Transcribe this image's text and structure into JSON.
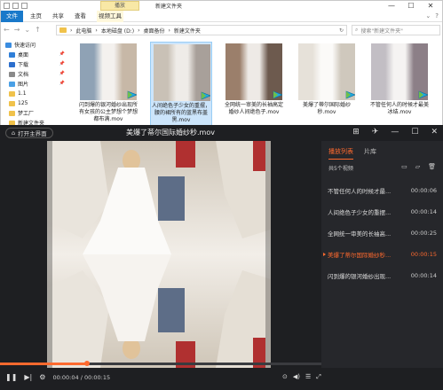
{
  "explorer": {
    "title": "新建文件夹",
    "context_tab": "播放",
    "window_controls": {
      "minimize": "—",
      "maximize": "☐",
      "close": "✕"
    },
    "ribbon": {
      "file": "文件",
      "tabs": [
        "主页",
        "共享",
        "查看",
        "视频工具"
      ]
    },
    "path": [
      "此电脑",
      "本地磁盘 (D:)",
      "桌面备份",
      "新建文件夹"
    ],
    "search_placeholder": "搜索\"新建文件夹\"",
    "sidebar": [
      {
        "label": "快速访问",
        "color": "#3b8de0",
        "head": true
      },
      {
        "label": "桌面",
        "color": "#2f7fd8",
        "pinned": true
      },
      {
        "label": "下载",
        "color": "#2c6fcd",
        "pinned": true
      },
      {
        "label": "文档",
        "color": "#8a8a8a",
        "pinned": true
      },
      {
        "label": "图片",
        "color": "#4aa0e6",
        "pinned": true
      },
      {
        "label": "1.1",
        "color": "#f0c24b"
      },
      {
        "label": "125",
        "color": "#f0c24b"
      },
      {
        "label": "梦工厂",
        "color": "#f0c24b"
      },
      {
        "label": "新建文件夹",
        "color": "#f0c24b"
      }
    ],
    "files": [
      {
        "name": "闪到爆的银河婚纱出现所有女孩的公主梦想个梦想都布满.mov",
        "colors": [
          "#8fa2b5",
          "#f4f1ee",
          "#c7b8a7"
        ],
        "selected": false
      },
      {
        "name": "人间绝色子少女的重摆，腰的裙所有的蓝黑布盖黑.mov",
        "colors": [
          "#c9c1b6",
          "#efece8",
          "#a8a09a"
        ],
        "selected": true
      },
      {
        "name": "全网统一审美的长袖高定婚纱人间绝色子.mov",
        "colors": [
          "#9b7f6b",
          "#eeeae6",
          "#6d5a4e"
        ],
        "selected": false
      },
      {
        "name": "美爆了蒂尔国际婚纱秒.mov",
        "colors": [
          "#e6e1d9",
          "#fbfaf8",
          "#cfc8bd"
        ],
        "selected": false
      },
      {
        "name": "不管任何人的时候才最美冰结.mov",
        "colors": [
          "#c2bec4",
          "#f5f3f2",
          "#8c7f87"
        ],
        "selected": false
      }
    ]
  },
  "player": {
    "open_home_label": "打开主界面",
    "title": "美爆了蒂尔国际婚纱秒.mov",
    "controls": [
      "⊞",
      "✈",
      "—",
      "☐",
      "✕"
    ],
    "playlist": {
      "tabs": [
        "播放列表",
        "片库"
      ],
      "count": "共5个视频",
      "items": [
        {
          "name": "不管任何人的时候才最...",
          "duration": "00:00:06",
          "current": false
        },
        {
          "name": "人间绝色子少女的重摆...",
          "duration": "00:00:14",
          "current": false
        },
        {
          "name": "全网统一审美的长袖高...",
          "duration": "00:00:25",
          "current": false
        },
        {
          "name": "美爆了蒂尔国际婚纱秒...",
          "duration": "00:00:15",
          "current": true
        },
        {
          "name": "闪到爆的银河婚纱出现...",
          "duration": "00:00:14",
          "current": false
        }
      ]
    },
    "progress": 0.27,
    "time": "00:00:04 / 00:00:15",
    "accent": "#ff6a2e"
  }
}
